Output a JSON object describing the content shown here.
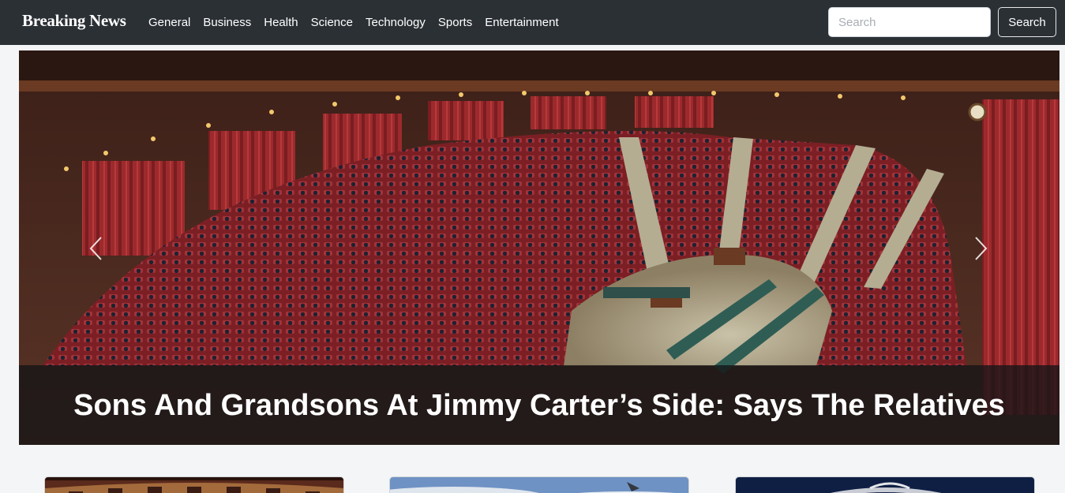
{
  "navbar": {
    "brand": "Breaking News",
    "links": [
      "General",
      "Business",
      "Health",
      "Science",
      "Technology",
      "Sports",
      "Entertainment"
    ],
    "search_placeholder": "Search",
    "search_button": "Search"
  },
  "carousel": {
    "caption": "Sons And Grandsons At Jimmy Carter’s Side: Says The Relatives",
    "prev_icon": "chevron-left-icon",
    "next_icon": "chevron-right-icon"
  },
  "colors": {
    "navbar_bg": "#2b3035",
    "page_bg": "#f4f5f7",
    "caption_overlay": "#141416"
  }
}
